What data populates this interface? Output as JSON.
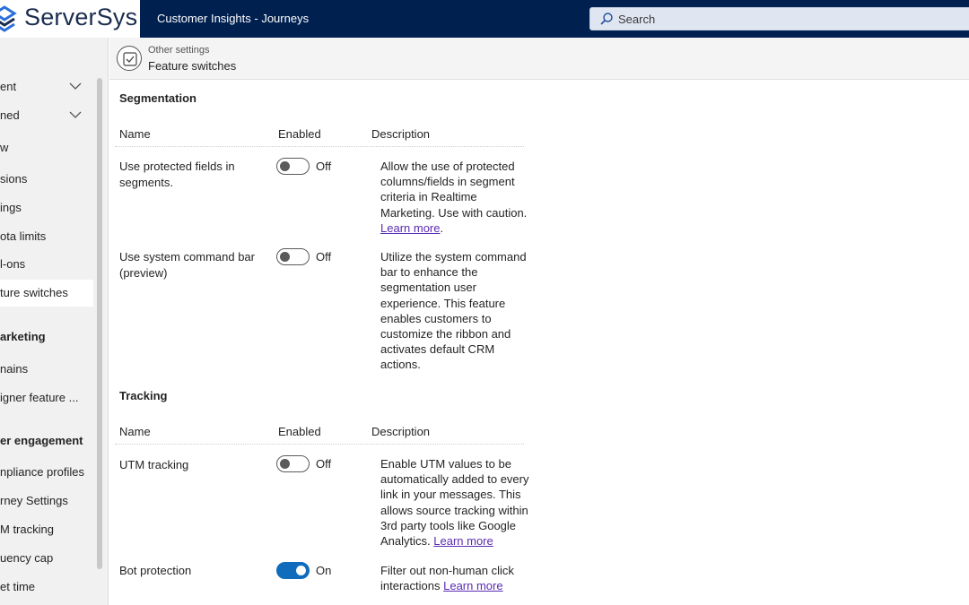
{
  "topbar": {
    "logo_text": "ServerSys",
    "app_title": "Customer Insights - Journeys",
    "search_placeholder": "Search"
  },
  "sidebar": {
    "items": [
      {
        "label": "ent",
        "type": "expandable"
      },
      {
        "label": "ned",
        "type": "expandable"
      },
      {
        "label": "w",
        "type": "item"
      },
      {
        "label": "sions",
        "type": "item"
      },
      {
        "label": "ings",
        "type": "item"
      },
      {
        "label": "ota limits",
        "type": "item"
      },
      {
        "label": "l-ons",
        "type": "item"
      },
      {
        "label": "ture switches",
        "type": "item",
        "selected": true
      },
      {
        "label": "arketing",
        "type": "group"
      },
      {
        "label": "nains",
        "type": "item"
      },
      {
        "label": "igner feature ...",
        "type": "item"
      },
      {
        "label": "er engagement",
        "type": "group"
      },
      {
        "label": "npliance profiles",
        "type": "item"
      },
      {
        "label": "rney Settings",
        "type": "item"
      },
      {
        "label": "M tracking",
        "type": "item"
      },
      {
        "label": "uency cap",
        "type": "item"
      },
      {
        "label": "et time",
        "type": "item"
      }
    ]
  },
  "header": {
    "breadcrumb": "Other settings",
    "title": "Feature switches"
  },
  "sections": [
    {
      "title": "Segmentation",
      "columns": [
        "Name",
        "Enabled",
        "Description"
      ],
      "rows": [
        {
          "name": "Use protected fields in segments.",
          "state": "Off",
          "description": "Allow the use of protected columns/fields in segment criteria in Realtime Marketing. Use with caution.",
          "link": "Learn more",
          "suffix": "."
        },
        {
          "name": "Use system command bar (preview)",
          "state": "Off",
          "description": "Utilize the system command bar to enhance the segmentation user experience. This feature enables customers to customize the ribbon and activates default CRM actions.",
          "link": "",
          "suffix": ""
        }
      ]
    },
    {
      "title": "Tracking",
      "columns": [
        "Name",
        "Enabled",
        "Description"
      ],
      "rows": [
        {
          "name": "UTM tracking",
          "state": "Off",
          "description": "Enable UTM values to be automatically added to every link in your messages. This allows source tracking within 3rd party tools like Google Analytics.",
          "link": "Learn more",
          "suffix": ""
        },
        {
          "name": "Bot protection",
          "state": "On",
          "description": "Filter out non-human click interactions",
          "link": "Learn more",
          "suffix": ""
        }
      ]
    }
  ],
  "colors": {
    "topbar_bg": "#002050",
    "toggle_on": "#0f6cbd",
    "link": "#5a2bb3"
  }
}
